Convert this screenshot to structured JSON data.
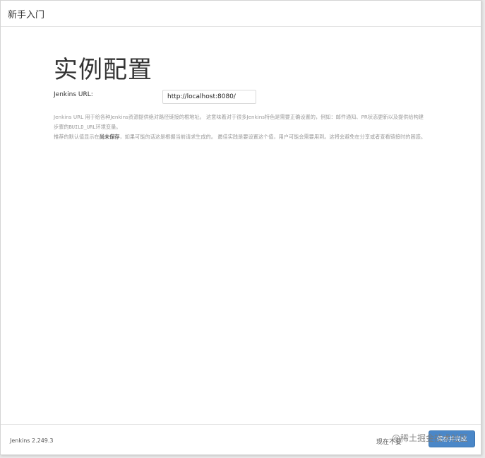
{
  "header": {
    "title": "新手入门"
  },
  "main": {
    "title": "实例配置",
    "url_field": {
      "label": "Jenkins URL:",
      "value": "http://localhost:8080/"
    },
    "help": {
      "p1": "Jenkins URL 用于给各种Jenkins资源提供绝对路径链接的根地址。 这意味着对于很多Jenkins特色是需要正确设置的，例如：邮件通知、PR状态更新以及提供给构建步骤的",
      "p1_code": "BUILD_URL",
      "p1_tail": "环境变量。",
      "p2_before": "推荐的默认值显示在",
      "p2_bold": "尚未保存",
      "p2_after": "，如果可能的话这是根据当前请求生成的。 最佳实践是要设置这个值，用户可能会需要用到。这将会避免在分享或者查看链接时的困惑。"
    }
  },
  "footer": {
    "version": "Jenkins 2.249.3",
    "secondary_button": "现在不要",
    "primary_button": "保存并完成",
    "watermark": "@稀土掘金技术社区"
  }
}
